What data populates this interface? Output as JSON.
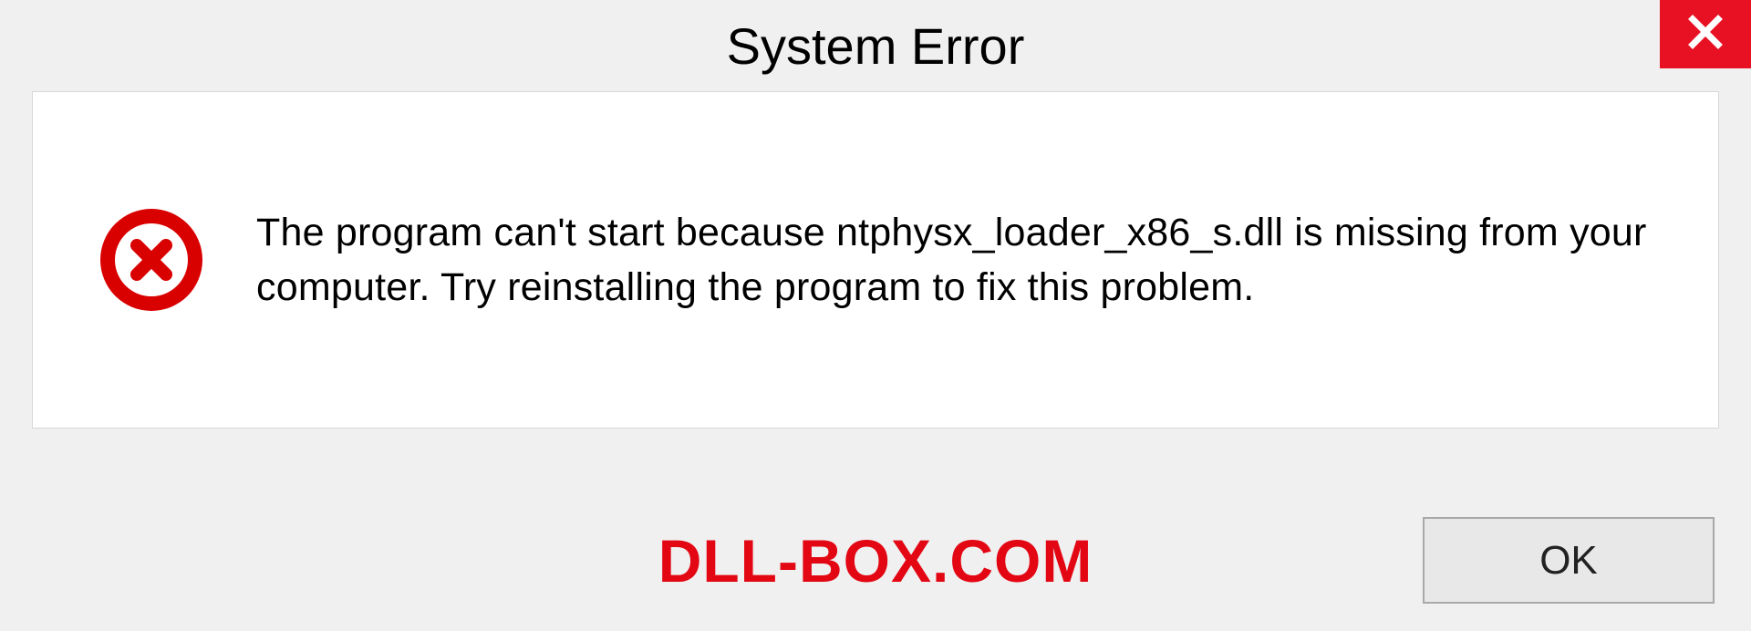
{
  "titlebar": {
    "title": "System Error"
  },
  "dialog": {
    "message": "The program can't start because ntphysx_loader_x86_s.dll is missing from your computer. Try reinstalling the program to fix this problem."
  },
  "footer": {
    "watermark": "DLL-BOX.COM",
    "ok_label": "OK"
  },
  "colors": {
    "close_bg": "#e81123",
    "error_icon": "#d90000",
    "watermark": "#e30613"
  }
}
